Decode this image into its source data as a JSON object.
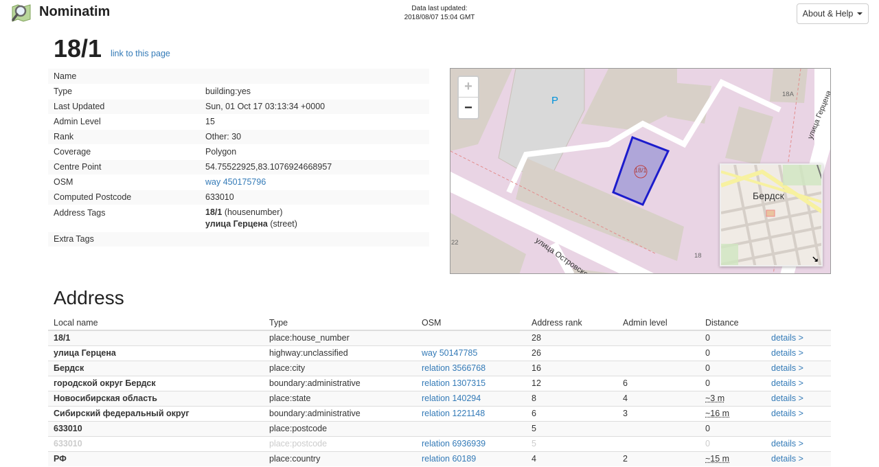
{
  "header": {
    "brand": "Nominatim",
    "updated_line1": "Data last updated:",
    "updated_line2": "2018/08/07 15:04 GMT",
    "help_label": "About & Help"
  },
  "page": {
    "title": "18/1",
    "permalink": "link to this page"
  },
  "details": [
    {
      "key": "Name",
      "value": ""
    },
    {
      "key": "Type",
      "value": "building:yes"
    },
    {
      "key": "Last Updated",
      "value": "Sun, 01 Oct 17 03:13:34 +0000"
    },
    {
      "key": "Admin Level",
      "value": "15"
    },
    {
      "key": "Rank",
      "value": "Other: 30"
    },
    {
      "key": "Coverage",
      "value": "Polygon"
    },
    {
      "key": "Centre Point",
      "value": "54.75522925,83.1076924668957"
    },
    {
      "key": "OSM",
      "value": "way 450175796"
    },
    {
      "key": "Computed Postcode",
      "value": "633010"
    },
    {
      "key": "Address Tags",
      "line1_bold": "18/1",
      "line1_rest": " (housenumber)",
      "line2_bold": "улица Герцена",
      "line2_rest": " (street)"
    },
    {
      "key": "Extra Tags",
      "value": ""
    }
  ],
  "map": {
    "parking_label": "P",
    "building_label_18a": "18A",
    "building_label_18": "18",
    "building_label_22": "22",
    "poly_label": "18/1",
    "street1": "улица Островского",
    "street2": "улица Герцена",
    "zoom_in": "+",
    "zoom_out": "−",
    "minimap_label": "Бердск",
    "minimap_toggle": "↘"
  },
  "address": {
    "heading": "Address",
    "columns": [
      "Local name",
      "Type",
      "OSM",
      "Address rank",
      "Admin level",
      "Distance",
      ""
    ],
    "rows": [
      {
        "name": "18/1",
        "type": "place:house_number",
        "osm": "",
        "rank": "28",
        "admin": "",
        "dist": "0",
        "details": "details >"
      },
      {
        "name": "улица Герцена",
        "type": "highway:unclassified",
        "osm": "way 50147785",
        "rank": "26",
        "admin": "",
        "dist": "0",
        "details": "details >"
      },
      {
        "name": "Бердск",
        "type": "place:city",
        "osm": "relation 3566768",
        "rank": "16",
        "admin": "",
        "dist": "0",
        "details": "details >"
      },
      {
        "name": "городской округ Бердск",
        "type": "boundary:administrative",
        "osm": "relation 1307315",
        "rank": "12",
        "admin": "6",
        "dist": "0",
        "details": "details >"
      },
      {
        "name": "Новосибирская область",
        "type": "place:state",
        "osm": "relation 140294",
        "rank": "8",
        "admin": "4",
        "dist": "~3 m",
        "details": "details >"
      },
      {
        "name": "Сибирский федеральный округ",
        "type": "boundary:administrative",
        "osm": "relation 1221148",
        "rank": "6",
        "admin": "3",
        "dist": "~16 m",
        "details": "details >"
      },
      {
        "name": "633010",
        "type": "place:postcode",
        "osm": "",
        "rank": "5",
        "admin": "",
        "dist": "0",
        "details": ""
      },
      {
        "name": "633010",
        "type": "place:postcode",
        "osm": "relation 6936939",
        "rank": "5",
        "admin": "",
        "dist": "0",
        "details": "details >",
        "faded": true
      },
      {
        "name": "РФ",
        "type": "place:country",
        "osm": "relation 60189",
        "rank": "4",
        "admin": "2",
        "dist": "~15 m",
        "details": "details >"
      }
    ]
  },
  "colors": {
    "link": "#337ab7",
    "polygon_stroke": "#1c1ccc",
    "polygon_fill": "#7f7fd0",
    "landuse": "#e9d4e4"
  }
}
